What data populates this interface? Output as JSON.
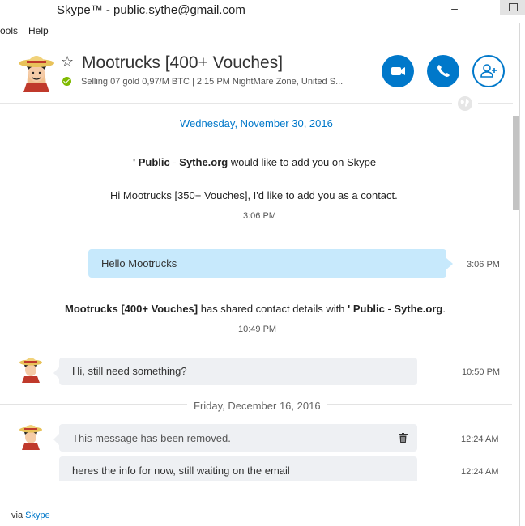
{
  "window": {
    "title": "Skype™ - public.sythe@gmail.com",
    "minimize": "–"
  },
  "menu": {
    "tools": "ools",
    "help": "Help"
  },
  "contact": {
    "name": "Mootrucks [400+ Vouches]",
    "mood": "Selling 07 gold 0,97/M BTC | 2:15 PM NightMare Zone, United S...",
    "presence_color": "#7fba00"
  },
  "icons": {
    "favorite": "star-outline-icon",
    "video": "video-camera-icon",
    "call": "phone-icon",
    "add": "add-contact-icon",
    "globe": "globe-icon",
    "trash": "trash-icon"
  },
  "colors": {
    "accent": "#0078ca",
    "bubble_out": "#c7e9fc",
    "bubble_in": "#eef0f3"
  },
  "conversation": {
    "date1": "Wednesday, November 30, 2016",
    "request_sender_prefix": "' ",
    "request_sender_name": "Public",
    "request_sender_sep": " - ",
    "request_sender_site": "Sythe.org",
    "request_suffix": " would like to add you on Skype",
    "request_message": "Hi Mootrucks [350+ Vouches], I'd like to add you as a contact.",
    "request_time": "3:06 PM",
    "out_message": "Hello Mootrucks",
    "out_time": "3:06 PM",
    "shared_name": "Mootrucks [400+ Vouches]",
    "shared_middle": " has shared contact details with ",
    "shared_prefix": "' ",
    "shared_target_name": "Public",
    "shared_target_sep": " - ",
    "shared_target_site": "Sythe.org",
    "shared_end": ".",
    "shared_time": "10:49 PM",
    "in_message1": "Hi, still need something?",
    "in_time1": "10:50 PM",
    "date2": "Friday, December 16, 2016",
    "removed_message": "This message has been removed.",
    "removed_time": "12:24 AM",
    "in_message3": "heres the info for now, still waiting on the email",
    "in_time3": "12:24 AM"
  },
  "footer": {
    "via": "via ",
    "skype": "Skype"
  }
}
